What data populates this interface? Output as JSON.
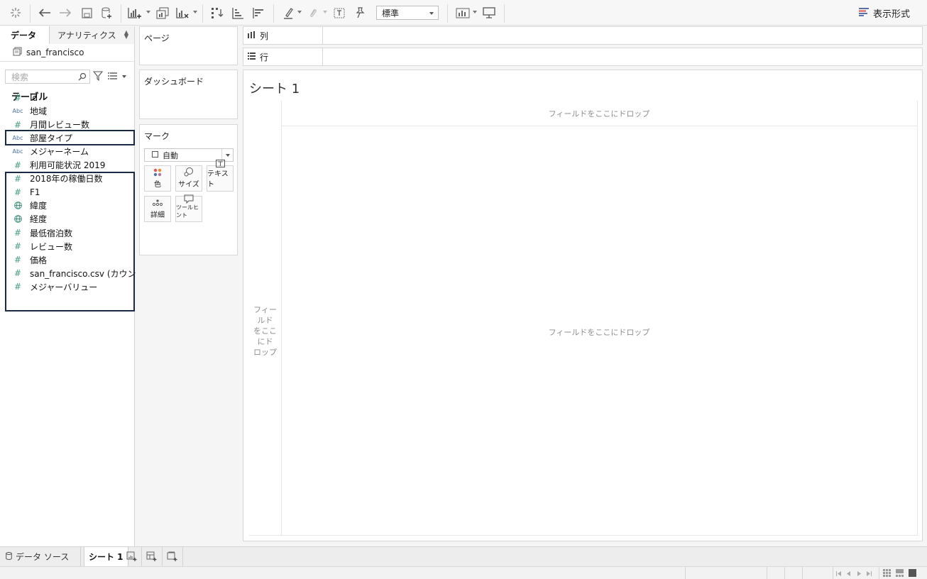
{
  "toolbar": {
    "zoom_value": "標準",
    "show_me_label": "表示形式"
  },
  "data_pane": {
    "tabs": [
      {
        "label": "データ"
      },
      {
        "label": "アナリティクス"
      }
    ],
    "datasource_name": "san_francisco",
    "search_placeholder": "検索",
    "tables_heading": "テーブル",
    "fields": [
      {
        "icon": "#",
        "type": "measure",
        "label": "Id"
      },
      {
        "icon": "Abc",
        "type": "dimension",
        "label": "地域"
      },
      {
        "icon": "#",
        "type": "measure",
        "label": "月間レビュー数"
      },
      {
        "icon": "Abc",
        "type": "dimension",
        "label": "部屋タイプ"
      },
      {
        "icon": "Abc",
        "type": "dimension",
        "label": "メジャーネーム"
      },
      {
        "icon": "#",
        "type": "measure",
        "label": "利用可能状況 2019"
      },
      {
        "icon": "#",
        "type": "measure",
        "label": "2018年の稼働日数"
      },
      {
        "icon": "#",
        "type": "measure",
        "label": "F1"
      },
      {
        "icon": "globe",
        "type": "geo",
        "label": "緯度"
      },
      {
        "icon": "globe",
        "type": "geo",
        "label": "経度"
      },
      {
        "icon": "#",
        "type": "measure",
        "label": "最低宿泊数"
      },
      {
        "icon": "#",
        "type": "measure",
        "label": "レビュー数"
      },
      {
        "icon": "#",
        "type": "measure",
        "label": "価格"
      },
      {
        "icon": "#",
        "type": "measure",
        "label": "san_francisco.csv (カウント)"
      },
      {
        "icon": "#",
        "type": "measure",
        "label": "メジャーバリュー"
      }
    ]
  },
  "shelves": {
    "pages_label": "ページ",
    "dashboard_label": "ダッシュボード",
    "marks_label": "マーク",
    "mark_type": "自動",
    "mark_buttons": [
      {
        "label": "色"
      },
      {
        "label": "サイズ"
      },
      {
        "label": "テキスト"
      },
      {
        "label": "詳細"
      },
      {
        "label": "ツールヒント"
      }
    ],
    "columns_label": "列",
    "rows_label": "行"
  },
  "sheet": {
    "title": "シート 1",
    "drop_hint_columns": "フィールドをここにドロップ",
    "drop_hint_center": "フィールドをここにドロップ",
    "drop_hint_rows_lines": [
      "フィー",
      "ルド",
      "をここ",
      "にド",
      "ロップ"
    ]
  },
  "bottom_tabs": {
    "datasource_tab": "データ ソース",
    "sheet_tab": "シート 1"
  }
}
